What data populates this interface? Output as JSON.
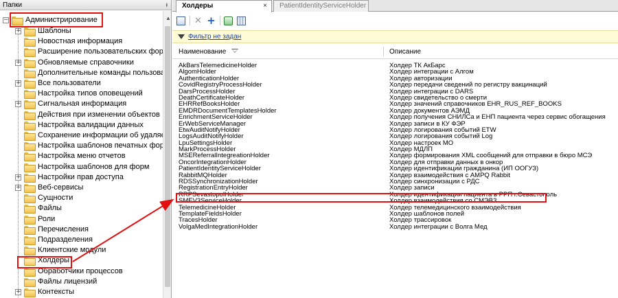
{
  "left_panel": {
    "title": "Папки",
    "pin_glyph": "ᵼ",
    "root": {
      "label": "Администрирование",
      "expander": "−"
    },
    "items": [
      {
        "label": "Шаблоны",
        "expander": "+"
      },
      {
        "label": "Новостная информация",
        "expander": ""
      },
      {
        "label": "Расширение пользовательских форм",
        "expander": ""
      },
      {
        "label": "Обновляемые справочники",
        "expander": "+"
      },
      {
        "label": "Дополнительные команды пользовате",
        "expander": ""
      },
      {
        "label": "Все пользователи",
        "expander": "+"
      },
      {
        "label": "Настройка типов оповещений",
        "expander": ""
      },
      {
        "label": "Сигнальная информация",
        "expander": "+"
      },
      {
        "label": "Действия при изменении объектов",
        "expander": ""
      },
      {
        "label": "Настройка валидации данных",
        "expander": ""
      },
      {
        "label": "Сохранение информации об удаляем",
        "expander": ""
      },
      {
        "label": "Настройка шаблонов печатных форм",
        "expander": ""
      },
      {
        "label": "Настройка меню отчетов",
        "expander": ""
      },
      {
        "label": "Настройка шаблонов для форм",
        "expander": ""
      },
      {
        "label": "Настройки прав доступа",
        "expander": "+"
      },
      {
        "label": "Веб-сервисы",
        "expander": "+"
      },
      {
        "label": "Сущности",
        "expander": ""
      },
      {
        "label": "Файлы",
        "expander": ""
      },
      {
        "label": "Роли",
        "expander": ""
      },
      {
        "label": "Перечисления",
        "expander": ""
      },
      {
        "label": "Подразделения",
        "expander": ""
      },
      {
        "label": "Клиентские модули",
        "expander": ""
      },
      {
        "label": "Холдеры",
        "expander": "",
        "open": true
      },
      {
        "label": "Обработчики процессов",
        "expander": ""
      },
      {
        "label": "Файлы лицензий",
        "expander": ""
      },
      {
        "label": "Контексты",
        "expander": "+"
      }
    ]
  },
  "tabs": [
    {
      "label": "Холдеры",
      "close": "×",
      "active": true
    },
    {
      "label": "PatientIdentityServiceHolder",
      "close": "",
      "active": false
    }
  ],
  "toolbar": {
    "edit_icon": "edit-icon",
    "delete_glyph": "✕",
    "add_glyph": "+",
    "refresh_icon": "refresh-icon",
    "settings_icon": "settings-icon"
  },
  "filter": {
    "text": "Фильтр не задан"
  },
  "grid": {
    "columns": {
      "name": "Наименование",
      "description": "Описание"
    },
    "rows": [
      {
        "name": "AkBarsTelemedicineHolder",
        "description": "Холдер ТК АкБарс"
      },
      {
        "name": "AlgomHolder",
        "description": "Холдер интеграции с Алгом"
      },
      {
        "name": "AuthenticationHolder",
        "description": "Холдер авторизации"
      },
      {
        "name": "CovidRegistryProcessHolder",
        "description": "Холдер передачи сведений по регистру вакцинаций"
      },
      {
        "name": "DarsProcessHolder",
        "description": "Холдер интеграции с DARS"
      },
      {
        "name": "DeathCertificateHolder",
        "description": "Холдер свидетельство о смерти"
      },
      {
        "name": "EHRRefBooksHolder",
        "description": "Холдер значений справочников EHR_RUS_REF_BOOKS"
      },
      {
        "name": "EMDRDocumentTemplatesHolder",
        "description": "Холдер документов АЭМД"
      },
      {
        "name": "EnrichmentServiceHolder",
        "description": "Холдер получения СНИЛСа и ЕНП пациента через сервис обогащения"
      },
      {
        "name": "ErWebServiceManager",
        "description": "Холдер записи в КУ ФЭР"
      },
      {
        "name": "EtwAuditNotifyHolder",
        "description": "Холдер логирования событий ETW"
      },
      {
        "name": "LogsAuditNotifyHolder",
        "description": "Холдер логирования событий Log"
      },
      {
        "name": "LpuSettingsHolder",
        "description": "Холдер настроек МО"
      },
      {
        "name": "MarkProcessHolder",
        "description": "Холдер МДЛП"
      },
      {
        "name": "MSEReferralIntegreationHolder",
        "description": "Холдер формирования XML сообщений для отправки в бюро МСЭ"
      },
      {
        "name": "OncorIntegrationHolder",
        "description": "Холдер для отправки данных в онкор"
      },
      {
        "name": "PatientIdentityServiceHolder",
        "description": "Холдер идентификации гражданина (ИП ООГУЗ)"
      },
      {
        "name": "RabbitMQHolder",
        "description": "Холдер взаимодействия с AMPQ Rabbit"
      },
      {
        "name": "RDSSynchronizationHolder",
        "description": "Холдер синхронизации с РДС"
      },
      {
        "name": "RegistrationEntryHolder",
        "description": "Холдер записи"
      },
      {
        "name": "RRPSevastopolHolder",
        "description": "Холдер идентификации пациента в РРП г.Севастополь"
      },
      {
        "name": "SMEV3ServiceHolder",
        "description": "Холдер взаимодействия со СМЭВ3"
      },
      {
        "name": "TelemedicineHolder",
        "description": "Холдер телемедицинского взаимодействия"
      },
      {
        "name": "TemplateFieldsHolder",
        "description": "Холдер шаблонов полей"
      },
      {
        "name": "TracesHolder",
        "description": "Холдер трассировок"
      },
      {
        "name": "VolgaMedIntegrationHolder",
        "description": "Холдер интеграции с Волга Мед"
      }
    ]
  },
  "colors": {
    "annotation": "#e01010",
    "filter_bg": "#fffbd6",
    "link": "#1a3fa0"
  }
}
